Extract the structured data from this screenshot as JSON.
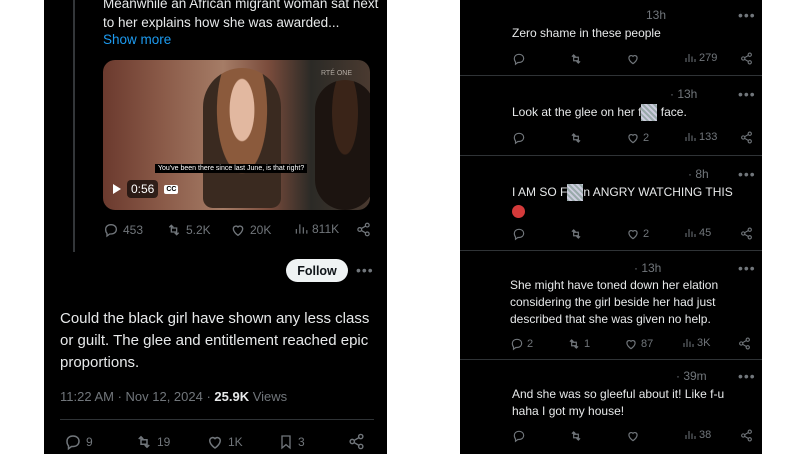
{
  "left": {
    "quoted_text": "Meanwhile an African migrant woman sat next to her explains how she was awarded...",
    "show_more": "Show more",
    "video": {
      "caption": "You've been there since last June, is that right?",
      "duration": "0:56",
      "cc": "CC",
      "watermark": "RTÉ ONE"
    },
    "quoted_actions": {
      "replies": "453",
      "reposts": "5.2K",
      "likes": "20K",
      "views": "811K"
    },
    "follow_label": "Follow",
    "tweet_text": "Could the black girl have shown any less class or guilt. The glee and entitlement reached epic proportions.",
    "time": "11:22 AM · Nov 12, 2024 · ",
    "views_count": "25.9K",
    "views_label": " Views",
    "actions": {
      "replies": "9",
      "reposts": "19",
      "likes": "1K",
      "bookmarks": "3"
    }
  },
  "replies": [
    {
      "time": "13h",
      "text": "Zero shame in these people",
      "replies": "",
      "reposts": "",
      "likes": "",
      "views": "279"
    },
    {
      "time": "· 13h",
      "text_before": "Look at the glee on her f",
      "censored": "ing",
      "text_after": " face.",
      "replies": "",
      "reposts": "",
      "likes": "2",
      "views": "133"
    },
    {
      "time": "· 8h",
      "text_before": "I AM SO F",
      "censored": "ing",
      "text_after": "n ANGRY WATCHING THIS",
      "replies": "",
      "reposts": "",
      "likes": "2",
      "views": "45"
    },
    {
      "time": "· 13h",
      "text": "She might have toned  down her elation considering the girl beside her had just described that she was given no help.",
      "replies": "2",
      "reposts": "1",
      "likes": "87",
      "views": "3K"
    },
    {
      "time": "· 39m",
      "text": "And she was so gleeful about it! Like f-u haha I got my house!",
      "replies": "",
      "reposts": "",
      "likes": "",
      "views": "38"
    }
  ],
  "colors": {
    "accent": "#1d9bf0",
    "background": "#000000",
    "muted": "#71767b"
  }
}
